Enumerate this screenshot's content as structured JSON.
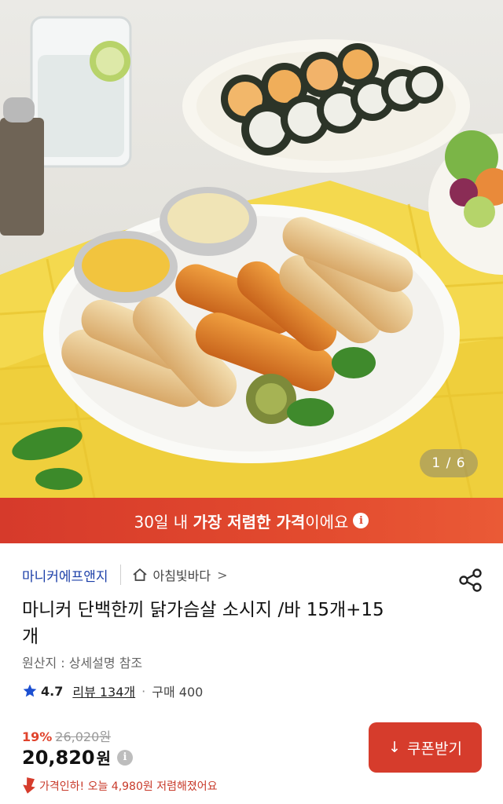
{
  "image": {
    "counter": "1 / 6",
    "icons": [
      "product-photo"
    ]
  },
  "banner": {
    "prefix": "30일 내 ",
    "highlight": "가장 저렴한 가격",
    "suffix": "이에요",
    "info_icon": "i"
  },
  "product": {
    "brand": "마니커에프앤지",
    "store": "아침빛바다",
    "store_chevron": ">",
    "title": "마니커 단백한끼 닭가슴살 소시지 /바 15개+15개",
    "origin": "원산지 : 상세설명 참조",
    "rating": "4.7",
    "reviews": "리뷰 134개",
    "separator": "·",
    "purchases": "구매 400"
  },
  "pricing": {
    "discount": "19%",
    "original_price": "26,020원",
    "price": "20,820",
    "price_unit": "원",
    "price_info": "i",
    "drop_notice": "가격인하! 오늘 4,980원 저렴해졌어요"
  },
  "coupon": {
    "label": "쿠폰받기",
    "arrow": "↓"
  },
  "colors": {
    "accent": "#d63c2c",
    "brand": "#1c3fa8",
    "star": "#1c4fd1"
  }
}
